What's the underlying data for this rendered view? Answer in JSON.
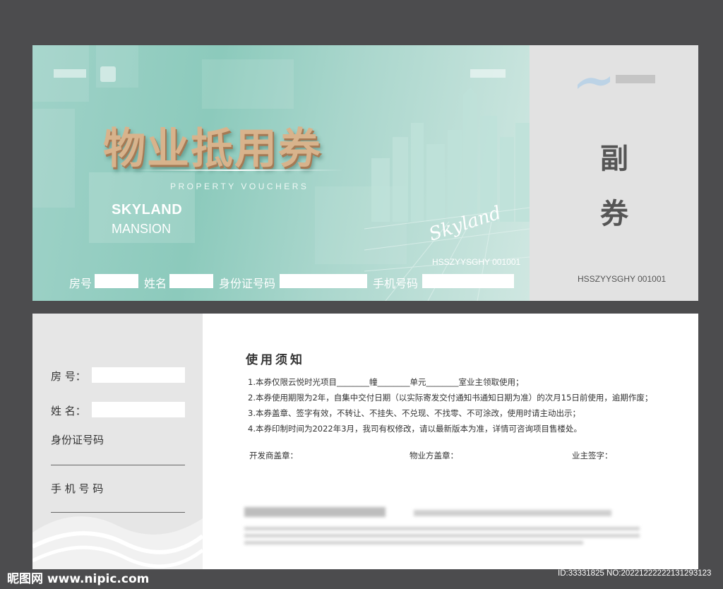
{
  "voucher": {
    "title": "物业抵用券",
    "subtitle": "PROPERTY VOUCHERS",
    "brand_line1": "SKYLAND",
    "brand_line2": "MANSION",
    "script_logo": "Skyland",
    "serial": "HSSZYYSGHY 001001",
    "fields": [
      {
        "label": "房号"
      },
      {
        "label": "姓名"
      },
      {
        "label": "身份证号码"
      },
      {
        "label": "手机号码"
      }
    ],
    "accent_color": "#9fd2c8",
    "title_color": "#d8b38c"
  },
  "stub": {
    "char1": "副",
    "char2": "券",
    "serial": "HSSZYYSGHY 001001",
    "background": "#e2e2e2"
  },
  "side_panel": {
    "room_label": "房 号：",
    "name_label": "姓 名：",
    "id_label": "身份证号码",
    "phone_label": "手 机 号 码"
  },
  "notice": {
    "title": "使用须知",
    "rules": [
      "1.本券仅限云悦时光项目________幢________单元________室业主领取使用；",
      "2.本券使用期限为2年，自集中交付日期（以实际寄发交付通知书通知日期为准）的次月15日前使用，逾期作废；",
      "3.本券盖章、签字有效，不转让、不挂失、不兑现、不找零、不可涂改，使用时请主动出示；",
      "4.本券印制时间为2022年3月，我司有权修改，请以最新版本为准，详情可咨询项目售楼处。"
    ],
    "signatures": [
      "开发商盖章：",
      "物业方盖章：",
      "业主签字："
    ]
  },
  "watermark": {
    "left": "昵图网 www.nipic.com",
    "right": "ID:33331825 NO:20221222222131293123"
  }
}
